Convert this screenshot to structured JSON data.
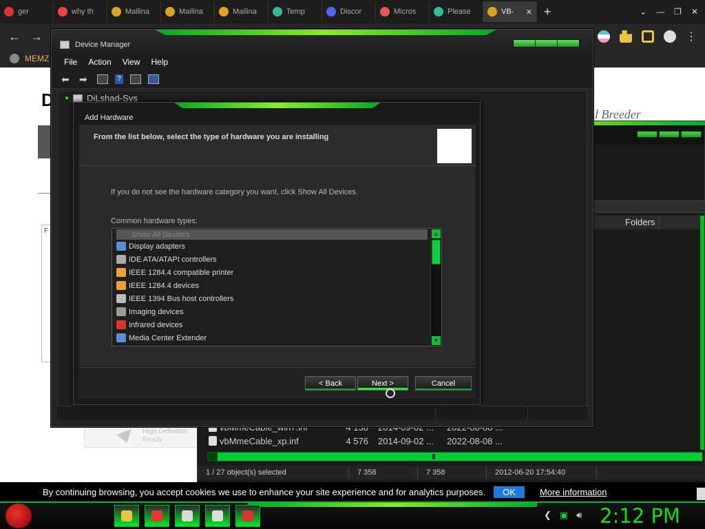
{
  "browser": {
    "tabs": [
      {
        "label": "ger",
        "color": "#d33"
      },
      {
        "label": "why th",
        "color": "#e44"
      },
      {
        "label": "Mailina",
        "color": "#d9a520"
      },
      {
        "label": "Mailina",
        "color": "#d9a520"
      },
      {
        "label": "Mailina",
        "color": "#d9a520"
      },
      {
        "label": "Temp",
        "color": "#3b9"
      },
      {
        "label": "Discor",
        "color": "#5865f2"
      },
      {
        "label": "Micros",
        "color": "#e55"
      },
      {
        "label": "Please",
        "color": "#3b9"
      },
      {
        "label": "VB-",
        "color": "#d9a520"
      }
    ],
    "bookmark_label": "MEMZ"
  },
  "webpage": {
    "letter": "D",
    "side_text": "F",
    "script_text": "l Breeder",
    "audio_title": "High Definition",
    "audio_status": "Ready"
  },
  "explorer": {
    "folders_header": "Folders",
    "files": [
      {
        "name": "vbMmeCable_win7.inf",
        "size": "4 138",
        "date1": "2014-09-02 ...",
        "date2": "2022-08-08 ..."
      },
      {
        "name": "vbMmeCable_xp.inf",
        "size": "4 576",
        "date1": "2014-09-02 ...",
        "date2": "2022-08-08 ..."
      }
    ],
    "status": {
      "selection": "1 / 27 object(s) selected",
      "size1": "7 358",
      "size2": "7 358",
      "modified": "2012-06-20 17:54:40"
    }
  },
  "device_manager": {
    "title": "Device Manager",
    "menu": [
      "File",
      "Action",
      "View",
      "Help"
    ],
    "computer_name": "DiLshad-Sys"
  },
  "add_hardware": {
    "title": "Add Hardware",
    "heading": "From the list below, select the type of hardware you are installing",
    "info": "If you do not see the hardware category you want, click Show All Devices.",
    "list_label": "Common hardware types:",
    "items": [
      {
        "label": "Show All Devices",
        "icon": "show-all",
        "color": "#777"
      },
      {
        "label": "Display adapters",
        "icon": "display",
        "color": "#5b8ed8"
      },
      {
        "label": "IDE ATA/ATAPI controllers",
        "icon": "ide",
        "color": "#aaa"
      },
      {
        "label": "IEEE 1284.4 compatible printer",
        "icon": "printer",
        "color": "#e9a13b"
      },
      {
        "label": "IEEE 1284.4 devices",
        "icon": "printer",
        "color": "#e9a13b"
      },
      {
        "label": "IEEE 1394 Bus host controllers",
        "icon": "bus",
        "color": "#bbb"
      },
      {
        "label": "Imaging devices",
        "icon": "camera",
        "color": "#999"
      },
      {
        "label": "Infrared devices",
        "icon": "infrared",
        "color": "#d33"
      },
      {
        "label": "Media Center Extender",
        "icon": "monitor",
        "color": "#5b8ed8"
      }
    ],
    "back_label": "< Back",
    "next_label": "Next >",
    "cancel_label": "Cancel"
  },
  "cookie_bar": {
    "text": "By continuing browsing, you accept cookies we use to enhance your site experience and for analytics purposes.",
    "ok_label": "OK",
    "more_label": "More information"
  },
  "taskbar": {
    "apps": [
      {
        "name": "explorer",
        "color": "#e8c547"
      },
      {
        "name": "chrome",
        "color": "#e33"
      },
      {
        "name": "paint",
        "color": "#d9d9d9"
      },
      {
        "name": "7zip",
        "color": "#ddd"
      },
      {
        "name": "device-manager",
        "color": "#d33"
      }
    ],
    "clock": "2:12 PM"
  }
}
